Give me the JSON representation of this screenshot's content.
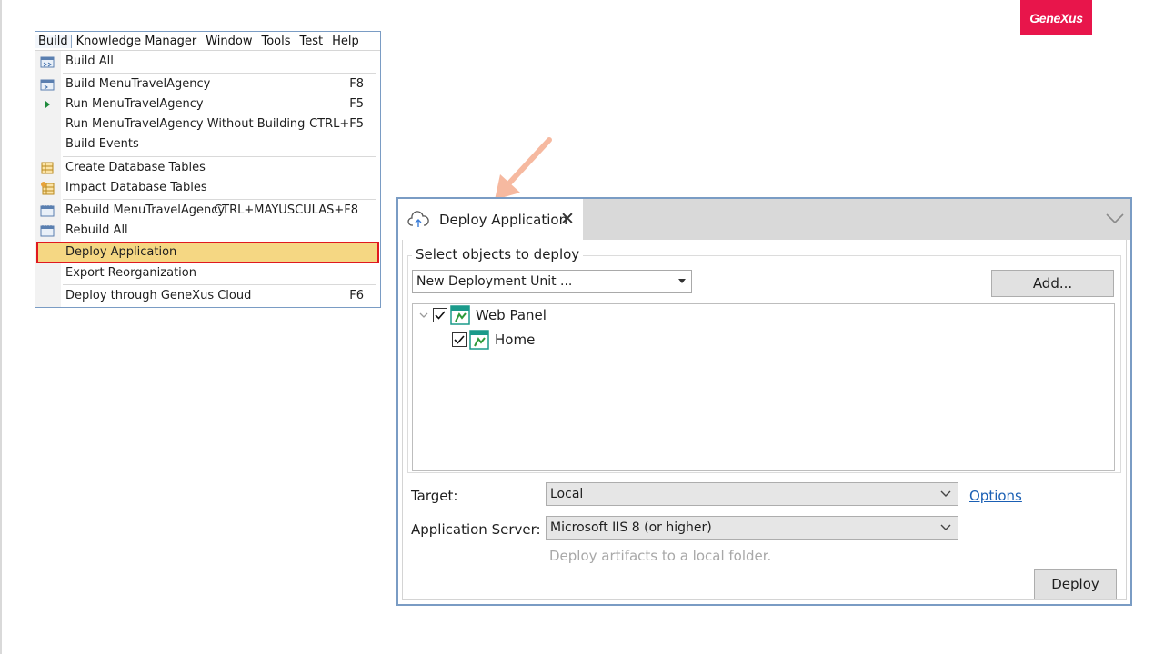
{
  "brand": {
    "logo_text": "GeneXus",
    "logo_color": "#e8154b"
  },
  "menubar": {
    "items": [
      "Build",
      "Knowledge Manager",
      "Window",
      "Tools",
      "Test",
      "Help"
    ]
  },
  "build_menu": {
    "items": [
      {
        "label": "Build All",
        "shortcut": "",
        "icon": "build-all-icon"
      },
      {
        "label": "Build MenuTravelAgency",
        "shortcut": "F8",
        "icon": "build-icon"
      },
      {
        "label": "Run MenuTravelAgency",
        "shortcut": "F5",
        "icon": "run-icon"
      },
      {
        "label": "Run MenuTravelAgency Without Building",
        "shortcut": "CTRL+F5",
        "icon": ""
      },
      {
        "label": "Build Events",
        "shortcut": "",
        "icon": ""
      },
      {
        "label": "Create Database Tables",
        "shortcut": "",
        "icon": "create-tables-icon"
      },
      {
        "label": "Impact Database Tables",
        "shortcut": "",
        "icon": "impact-tables-icon"
      },
      {
        "label": "Rebuild MenuTravelAgency",
        "shortcut": "CTRL+MAYUSCULAS+F8",
        "icon": "rebuild-icon"
      },
      {
        "label": "Rebuild All",
        "shortcut": "",
        "icon": "rebuild-all-icon"
      },
      {
        "label": "Deploy Application",
        "shortcut": "",
        "icon": "",
        "highlighted": true
      },
      {
        "label": "Export Reorganization",
        "shortcut": "",
        "icon": ""
      },
      {
        "label": "Deploy through GeneXus Cloud",
        "shortcut": "F6",
        "icon": ""
      }
    ]
  },
  "deploy_window": {
    "tab_title": "Deploy Application",
    "select_label": "Select objects to deploy",
    "deployment_unit": "New Deployment Unit ...",
    "add_button": "Add...",
    "tree": [
      {
        "label": "Web Panel",
        "checked": true
      },
      {
        "label": "Home",
        "checked": true
      }
    ],
    "target_label": "Target:",
    "target_value": "Local",
    "options_link": "Options",
    "app_server_label": "Application Server:",
    "app_server_value": "Microsoft IIS 8 (or higher)",
    "hint": "Deploy artifacts to a local folder.",
    "deploy_button": "Deploy"
  },
  "colors": {
    "highlight_fill": "#f5d783",
    "highlight_border": "#e0191f",
    "arrow": "#f6b9a0",
    "link": "#1a5fb4"
  }
}
